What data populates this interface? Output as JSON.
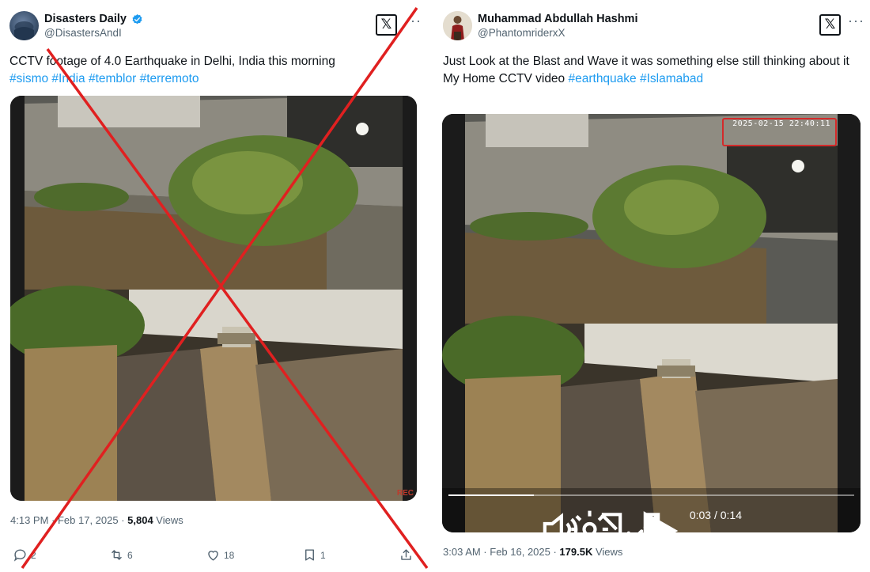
{
  "left_post": {
    "author_name": "Disasters Daily",
    "handle": "@DisastersAndI",
    "verified": true,
    "x_logo": "x-logo-icon",
    "more_label": "···",
    "text_plain": "CCTV footage of 4.0 Earthquake in Delhi, India this morning",
    "hashtags": [
      "#sismo",
      "#India",
      "#temblor",
      "#terremoto"
    ],
    "rec_label": "REC",
    "timestamp": "4:13 PM · Feb 17, 2025 · ",
    "views_count": "5,804",
    "views_label": " Views",
    "actions": {
      "replies": "2",
      "reposts": "6",
      "likes": "18",
      "bookmarks": "1"
    }
  },
  "right_post": {
    "author_name": "Muhammad Abdullah Hashmi",
    "handle": "@PhantomriderxX",
    "x_logo": "x-logo-icon",
    "more_label": "···",
    "text_line1": "Just Look at the Blast and Wave it was something else still thinking about it",
    "text_line2_plain": "My Home CCTV video ",
    "hashtags": [
      "#earthquake",
      "#Islamabad"
    ],
    "osd_timestamp": "2025-02-15 22:40:11",
    "video": {
      "current_time": "0:03",
      "duration": "0:14",
      "time_separator": " / ",
      "progress_fraction": 0.21
    },
    "timestamp": "3:03 AM · Feb 16, 2025 · ",
    "views_count": "179.5K",
    "views_label": " Views"
  },
  "overlay": {
    "type": "red-x-cross-out",
    "color": "#e02020"
  },
  "colors": {
    "link": "#1d9bf0",
    "text": "#0f1419",
    "secondary": "#536471",
    "verified": "#1d9bf0"
  }
}
